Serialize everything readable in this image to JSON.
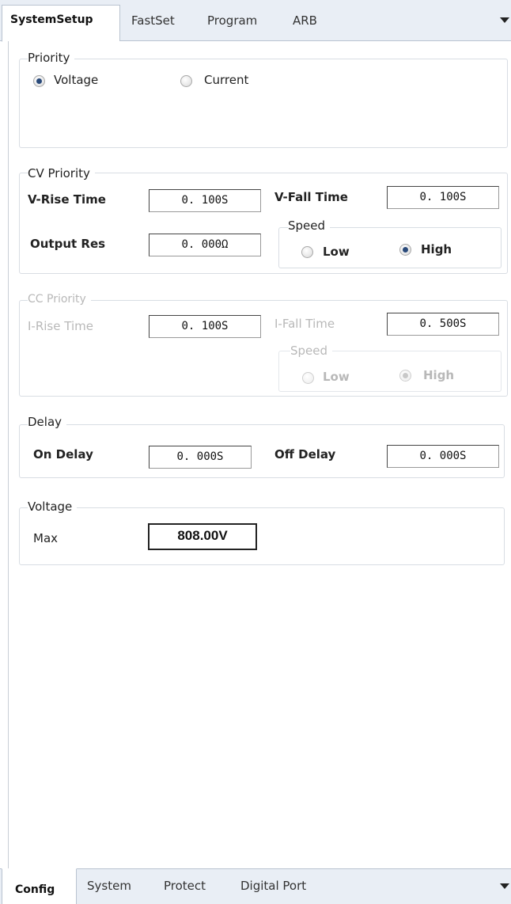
{
  "top_tabs": {
    "system_setup": "SystemSetup",
    "fastset": "FastSet",
    "program": "Program",
    "arb": "ARB"
  },
  "priority": {
    "legend": "Priority",
    "voltage": "Voltage",
    "current": "Current",
    "selected": "Voltage"
  },
  "cv_priority": {
    "legend": "CV Priority",
    "v_rise_label": "V-Rise Time",
    "v_rise_value": "0. 100S",
    "v_fall_label": "V-Fall Time",
    "v_fall_value": "0. 100S",
    "output_res_label": "Output Res",
    "output_res_value": "0. 000Ω",
    "speed_legend": "Speed",
    "speed_low": "Low",
    "speed_high": "High",
    "speed_selected": "High"
  },
  "cc_priority": {
    "legend": "CC Priority",
    "i_rise_label": "I-Rise Time",
    "i_rise_value": "0. 100S",
    "i_fall_label": "I-Fall Time",
    "i_fall_value": "0. 500S",
    "speed_legend": "Speed",
    "speed_low": "Low",
    "speed_high": "High",
    "speed_selected": "High"
  },
  "delay": {
    "legend": "Delay",
    "on_label": "On Delay",
    "on_value": "0. 000S",
    "off_label": "Off Delay",
    "off_value": "0. 000S"
  },
  "voltage": {
    "legend": "Voltage",
    "max_label": "Max",
    "max_value": "808.00V"
  },
  "bottom_tabs": {
    "config": "Config",
    "system": "System",
    "protect": "Protect",
    "digital_port": "Digital Port"
  },
  "colors": {
    "tab_bar": "#e9eef5",
    "radio_dot": "#2a4a7a",
    "disabled_text": "#b8b8b8"
  }
}
